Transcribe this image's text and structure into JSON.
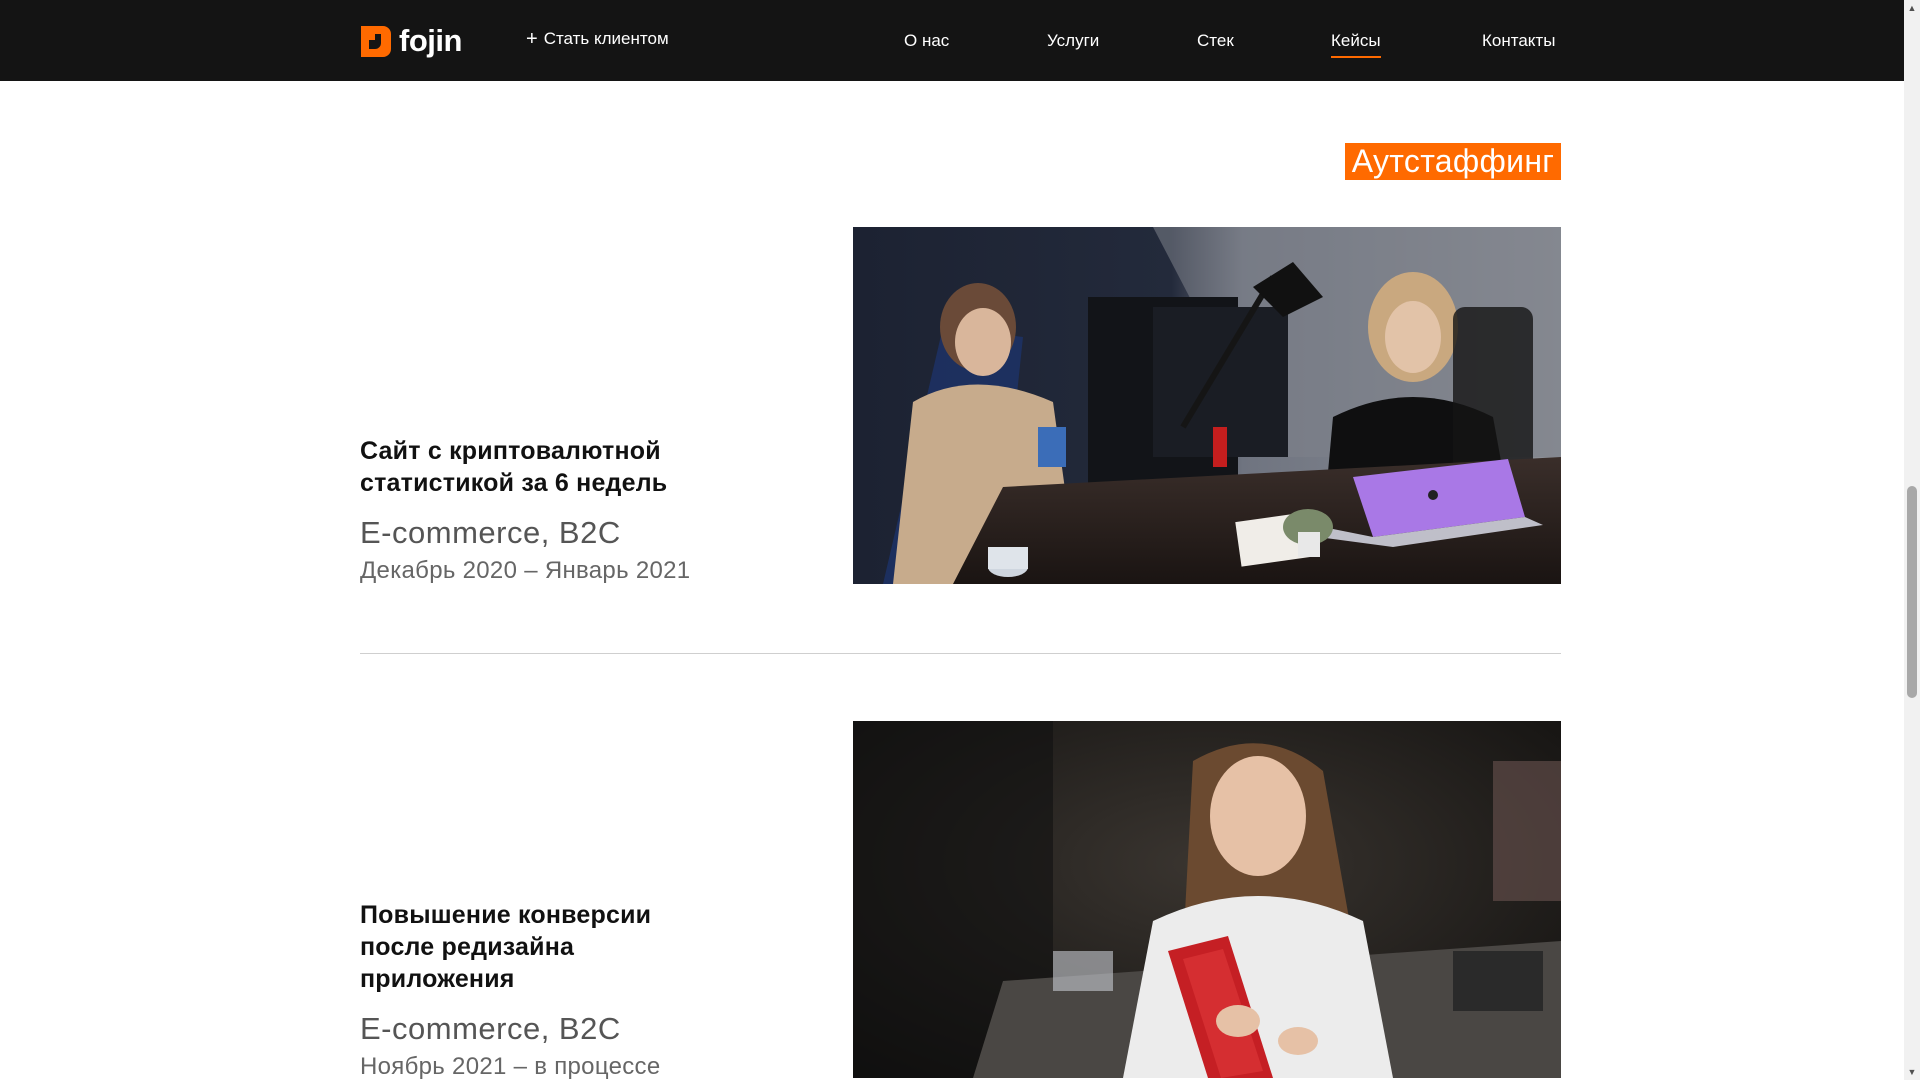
{
  "header": {
    "logo_text": "fojin",
    "become_client": "Стать клиентом",
    "nav": [
      {
        "label": "О нас"
      },
      {
        "label": "Услуги"
      },
      {
        "label": "Стек"
      },
      {
        "label": "Кейсы",
        "active": true
      },
      {
        "label": "Контакты"
      }
    ]
  },
  "section_tag": "Аутстаффинг",
  "cases": [
    {
      "title_line1": "Сайт с криптовалютной",
      "title_line2": "статистикой за 6 недель",
      "category": "E-commerce, B2C",
      "dates": "Декабрь 2020 – Январь 2021",
      "image_alt": "two-developers-at-desk-photo"
    },
    {
      "title_line1": "Повышение конверсии",
      "title_line2": "после редизайна",
      "title_line3": "приложения",
      "category": "E-commerce, B2C",
      "dates": "Ноябрь 2021 – в процессе",
      "image_alt": "woman-holding-red-laptop-photo"
    }
  ],
  "colors": {
    "accent": "#ff6a00",
    "header_bg": "#141414",
    "divider": "#cfcfcf"
  }
}
